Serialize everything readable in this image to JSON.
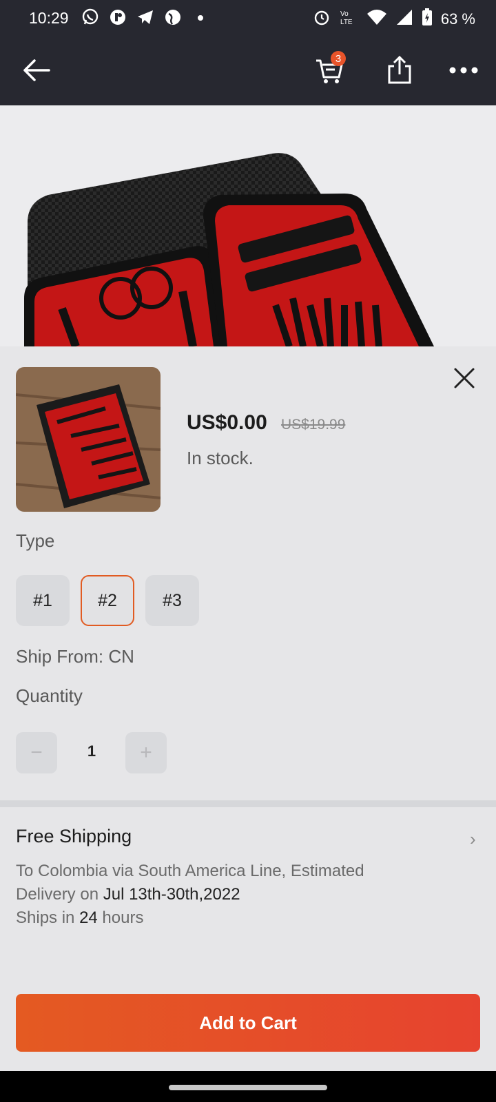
{
  "status_bar": {
    "time": "10:29",
    "battery": "63 %",
    "left_icons": [
      "whatsapp-icon",
      "app-icon",
      "telegram-icon",
      "globe-icon",
      "dot-icon"
    ],
    "right_icons": [
      "alarm-icon",
      "volte-icon",
      "wifi-icon",
      "signal-icon",
      "battery-icon"
    ]
  },
  "top_bar": {
    "cart_count": "3",
    "icons": [
      "back-arrow-icon",
      "cart-icon",
      "share-icon",
      "more-icon"
    ]
  },
  "product": {
    "price": "US$0.00",
    "original_price": "US$19.99",
    "stock": "In stock."
  },
  "type": {
    "label": "Type",
    "options": [
      "#1",
      "#2",
      "#3"
    ],
    "selected": "#2"
  },
  "ship_from": "Ship From: CN",
  "quantity": {
    "label": "Quantity",
    "value": "1",
    "minus": "−",
    "plus": "+"
  },
  "shipping": {
    "title": "Free Shipping",
    "line1": "To Colombia via South America Line, Estimated",
    "line2_prefix": "Delivery on ",
    "line2_date": "Jul 13th-30th,2022",
    "line3_prefix": "Ships in ",
    "line3_hours": "24",
    "line3_suffix": " hours"
  },
  "add_to_cart": "Add to Cart",
  "colors": {
    "accent": "#e15b22",
    "button_start": "#e45a22",
    "button_end": "#e6432f",
    "topbar": "#272830"
  }
}
